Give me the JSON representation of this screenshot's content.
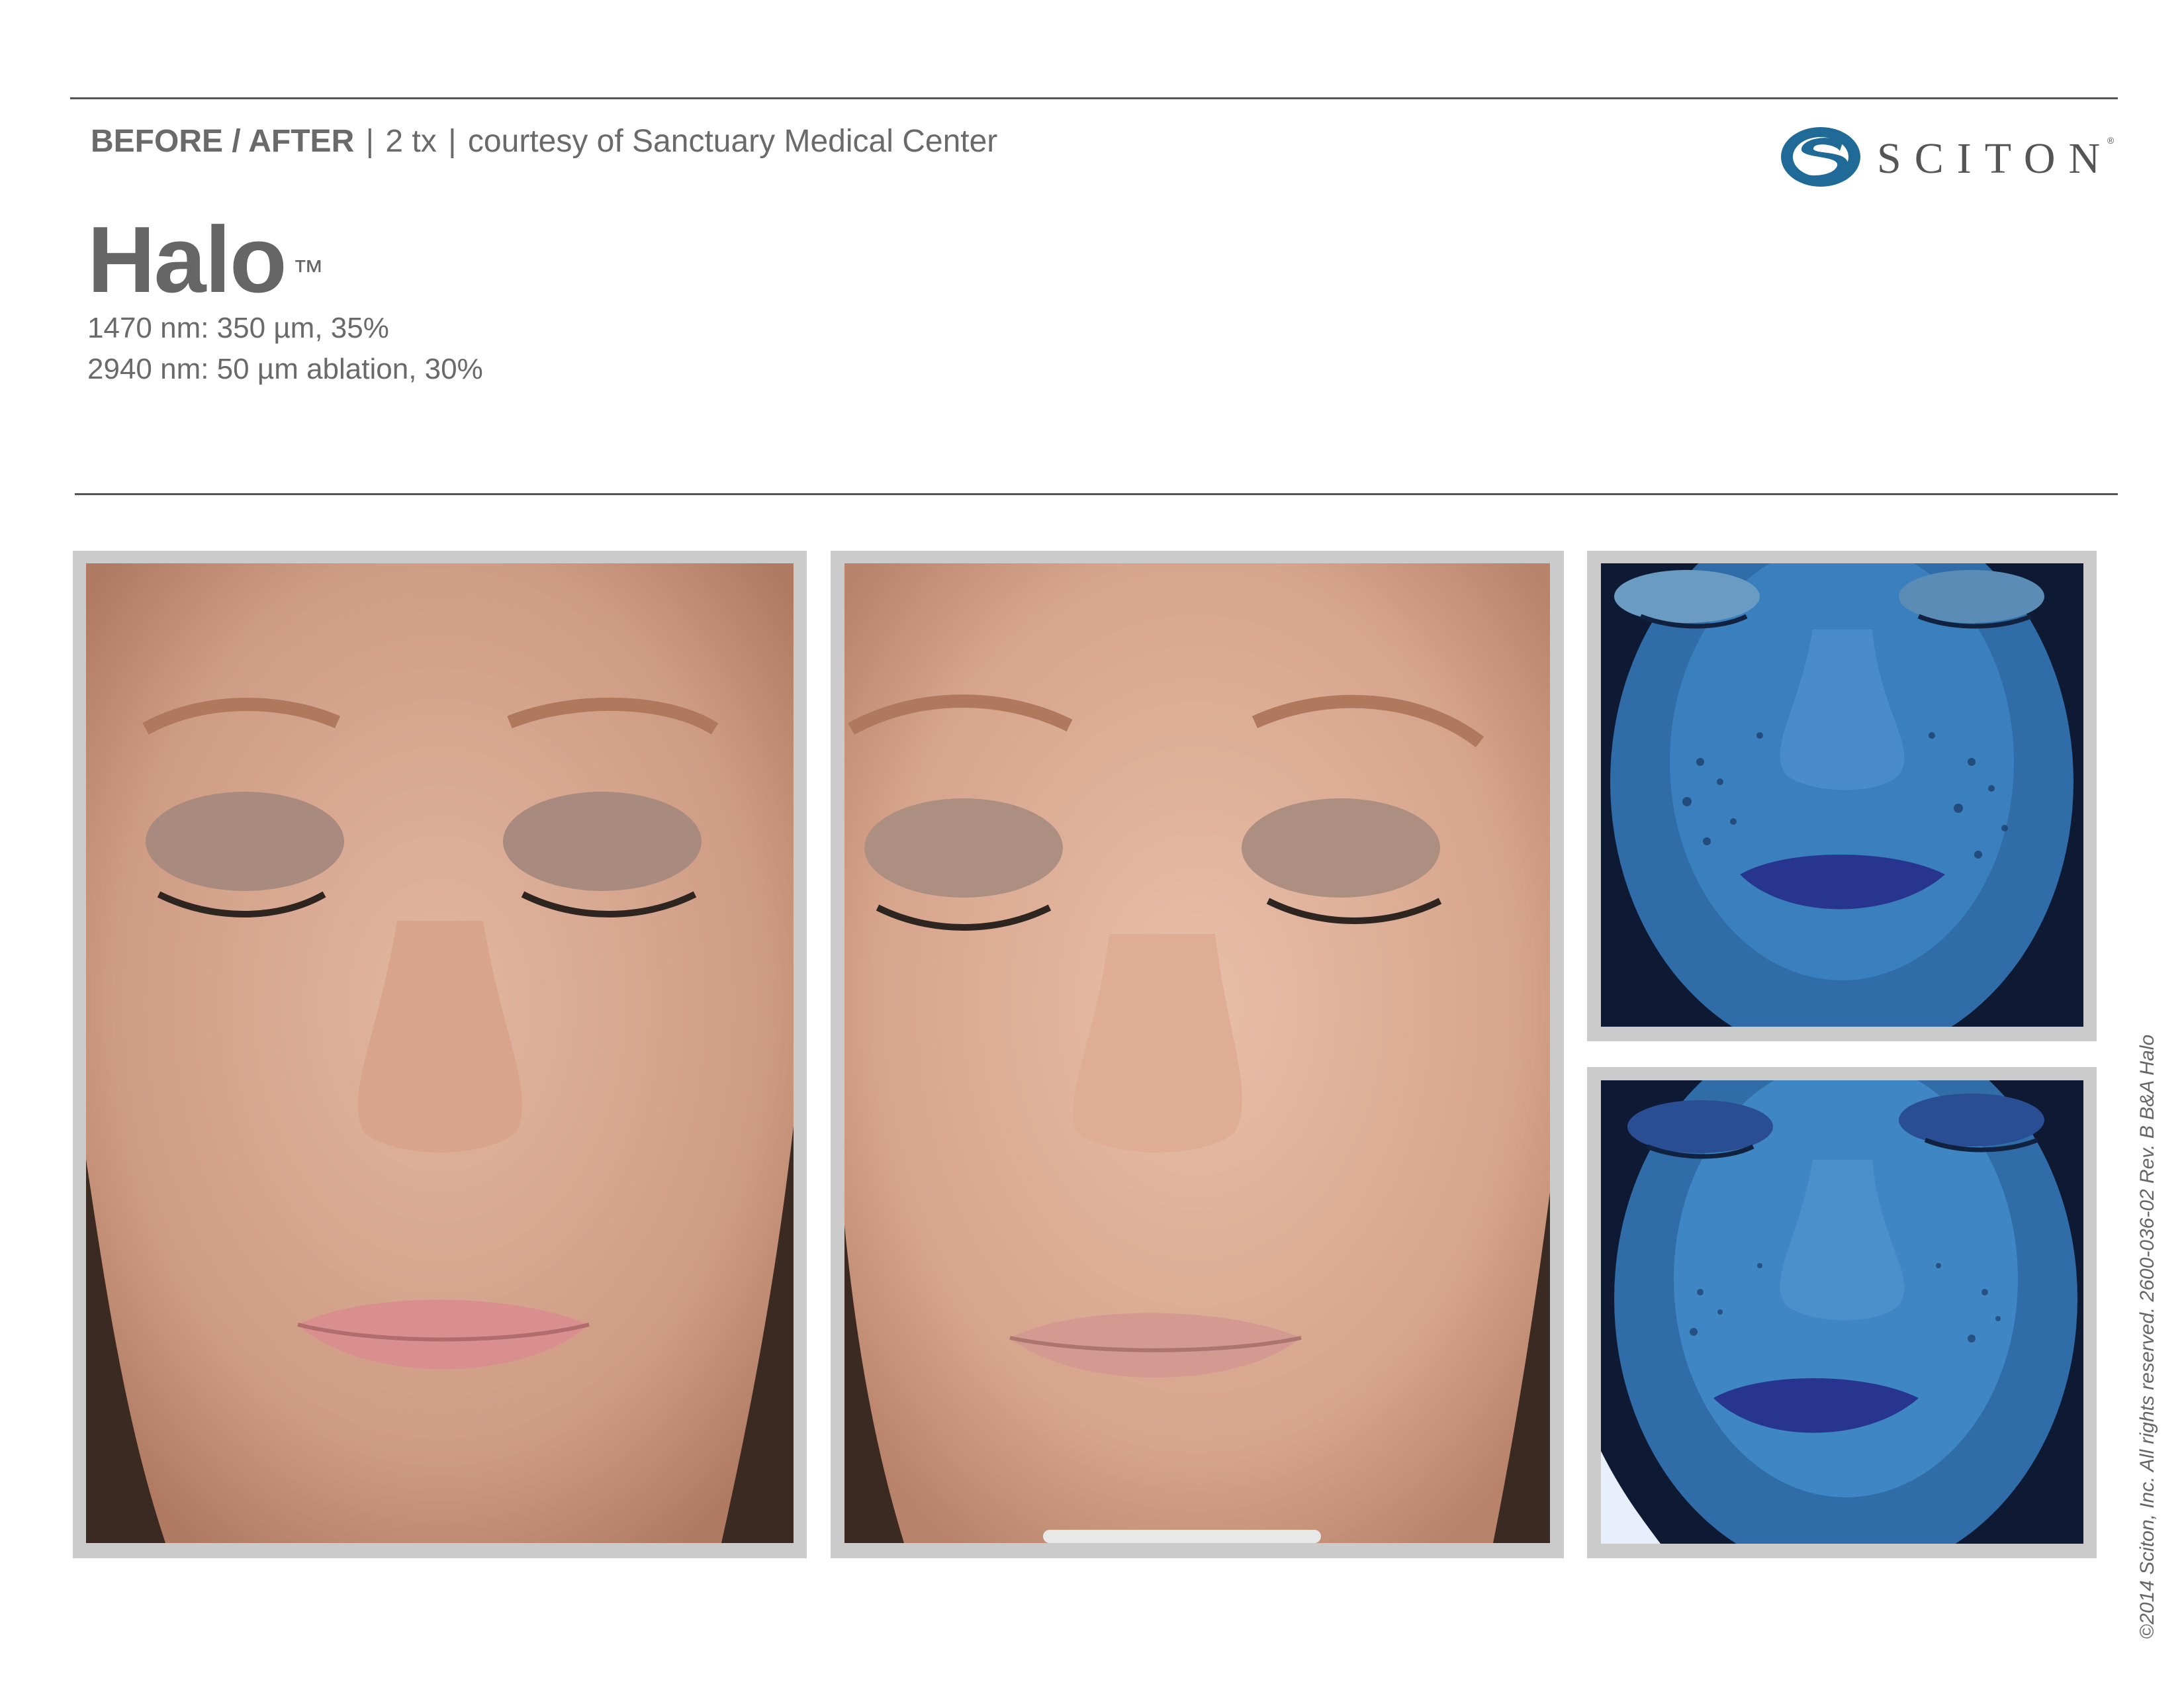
{
  "header": {
    "label_bold": "BEFORE / AFTER",
    "separator_1": "|",
    "treatments": "2 tx",
    "separator_2": "|",
    "courtesy": "courtesy of Sanctuary Medical Center"
  },
  "product": {
    "name": "Halo",
    "trademark": "™",
    "spec_1470": "1470 nm: 350 µm, 35%",
    "spec_2940": "2940 nm: 50 µm ablation, 30%"
  },
  "brand": {
    "name": "SCITON",
    "registered": "®",
    "logo_icon": "sciton-s-icon",
    "accent_color": "#1f6a96"
  },
  "photos": [
    {
      "name": "before-photo",
      "icon": "face-natural-light"
    },
    {
      "name": "after-photo",
      "icon": "face-natural-light"
    },
    {
      "name": "before-uv-photo",
      "icon": "face-uv-light"
    },
    {
      "name": "after-uv-photo",
      "icon": "face-uv-light"
    }
  ],
  "footer": {
    "copyright": "©2014 Sciton, Inc. All rights reserved. 2600-036-02 Rev. B B&A Halo"
  }
}
